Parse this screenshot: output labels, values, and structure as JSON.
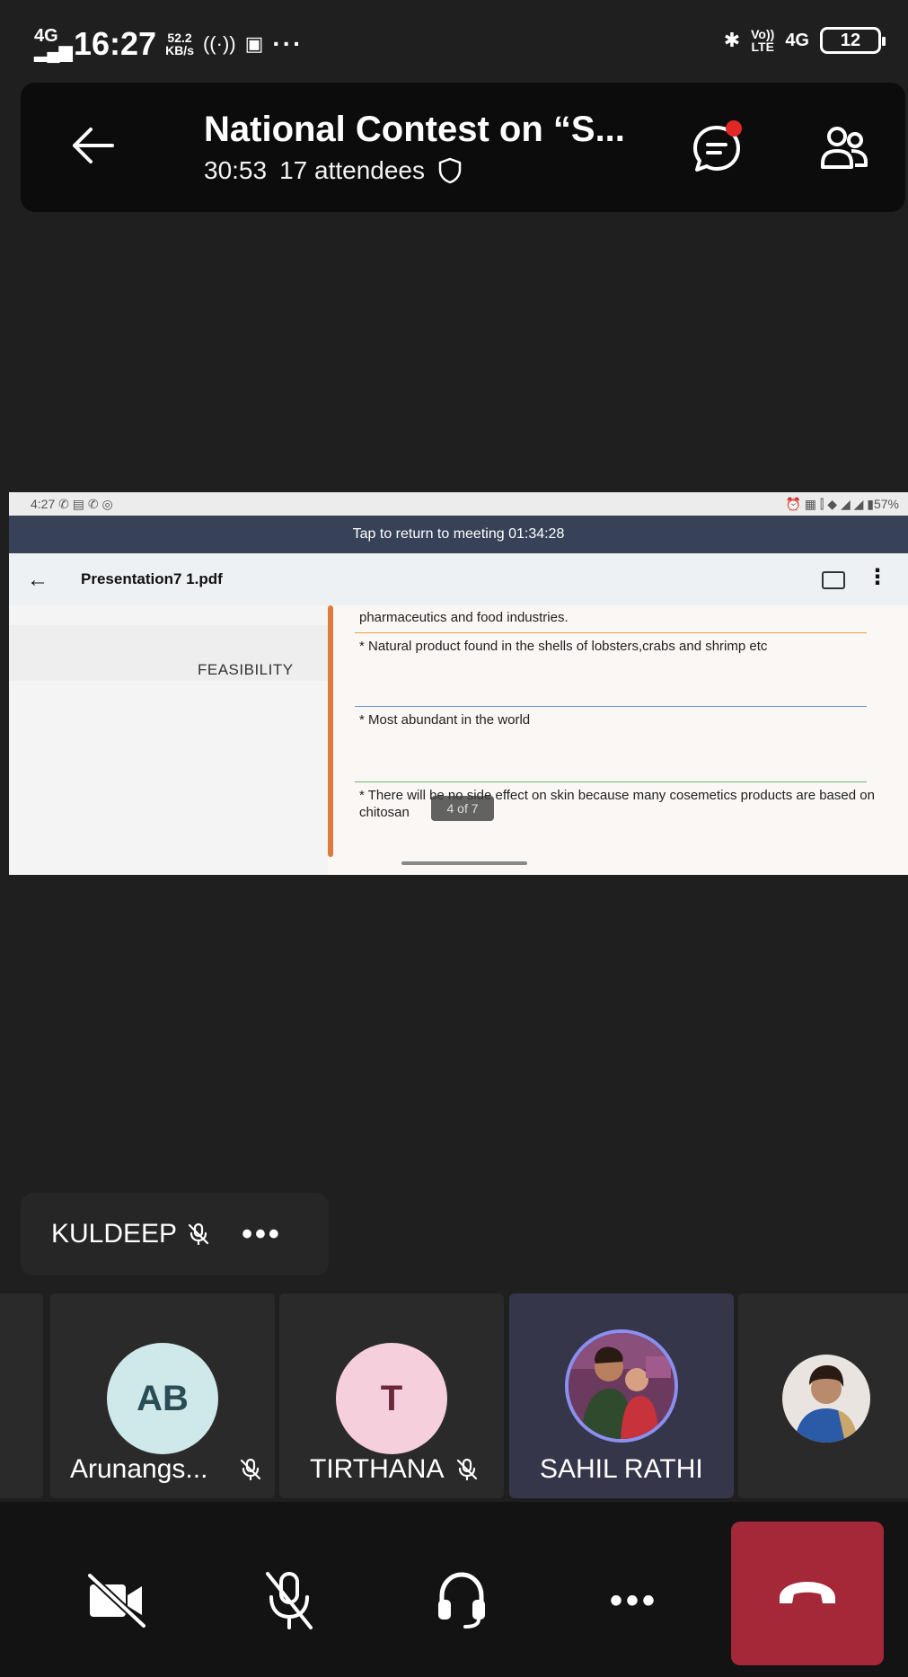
{
  "status_bar": {
    "network_left": "4G",
    "time": "16:27",
    "speed_value": "52.2",
    "speed_unit": "KB/s",
    "right_volte": "Vo))",
    "right_lte": "LTE",
    "right_4g": "4G",
    "battery": "12"
  },
  "header": {
    "title": "National Contest on “S...",
    "duration": "30:53",
    "attendees": "17 attendees"
  },
  "shared_screen": {
    "inner_status_time": "4:27",
    "inner_status_battery": "57%",
    "banner": "Tap to return to meeting 01:34:28",
    "file_name": "Presentation7 1.pdf",
    "slide": {
      "section_label": "FEASIBILITY",
      "line_top": "pharmaceutics and food industries.",
      "bullet_1": "* Natural product found in the shells of lobsters,crabs and shrimp etc",
      "bullet_2": "* Most abundant in the world",
      "bullet_3": "* There will be no side effect on skin because many cosemetics  products are based on chitosan",
      "page_indicator": "4 of 7",
      "rule_colors": [
        "#e6a24a",
        "#6a9bd1",
        "#6ab87a"
      ],
      "bar_color": "#e07a3a"
    }
  },
  "active_speaker": {
    "name": "KULDEEP"
  },
  "participants": [
    {
      "name": "Arunangs...",
      "initials": "AB",
      "avatar_bg": "#cfe9ea",
      "avatar_fg": "#2a4d55",
      "muted": true
    },
    {
      "name": "TIRTHANA",
      "initials": "T",
      "avatar_bg": "#f6cfdc",
      "avatar_fg": "#6a2838",
      "muted": true
    },
    {
      "name": "SAHIL RATHI",
      "initials": "",
      "avatar_bg": "#7a4a6a",
      "muted": false,
      "active": true
    },
    {
      "name": "",
      "initials": "",
      "avatar_bg": "#c9b7a5",
      "muted": false
    }
  ],
  "controls": {
    "camera": "camera-off",
    "mic": "mic-off",
    "audio": "headset",
    "more": "more",
    "leave": "hang-up",
    "leave_color": "#a42838"
  }
}
